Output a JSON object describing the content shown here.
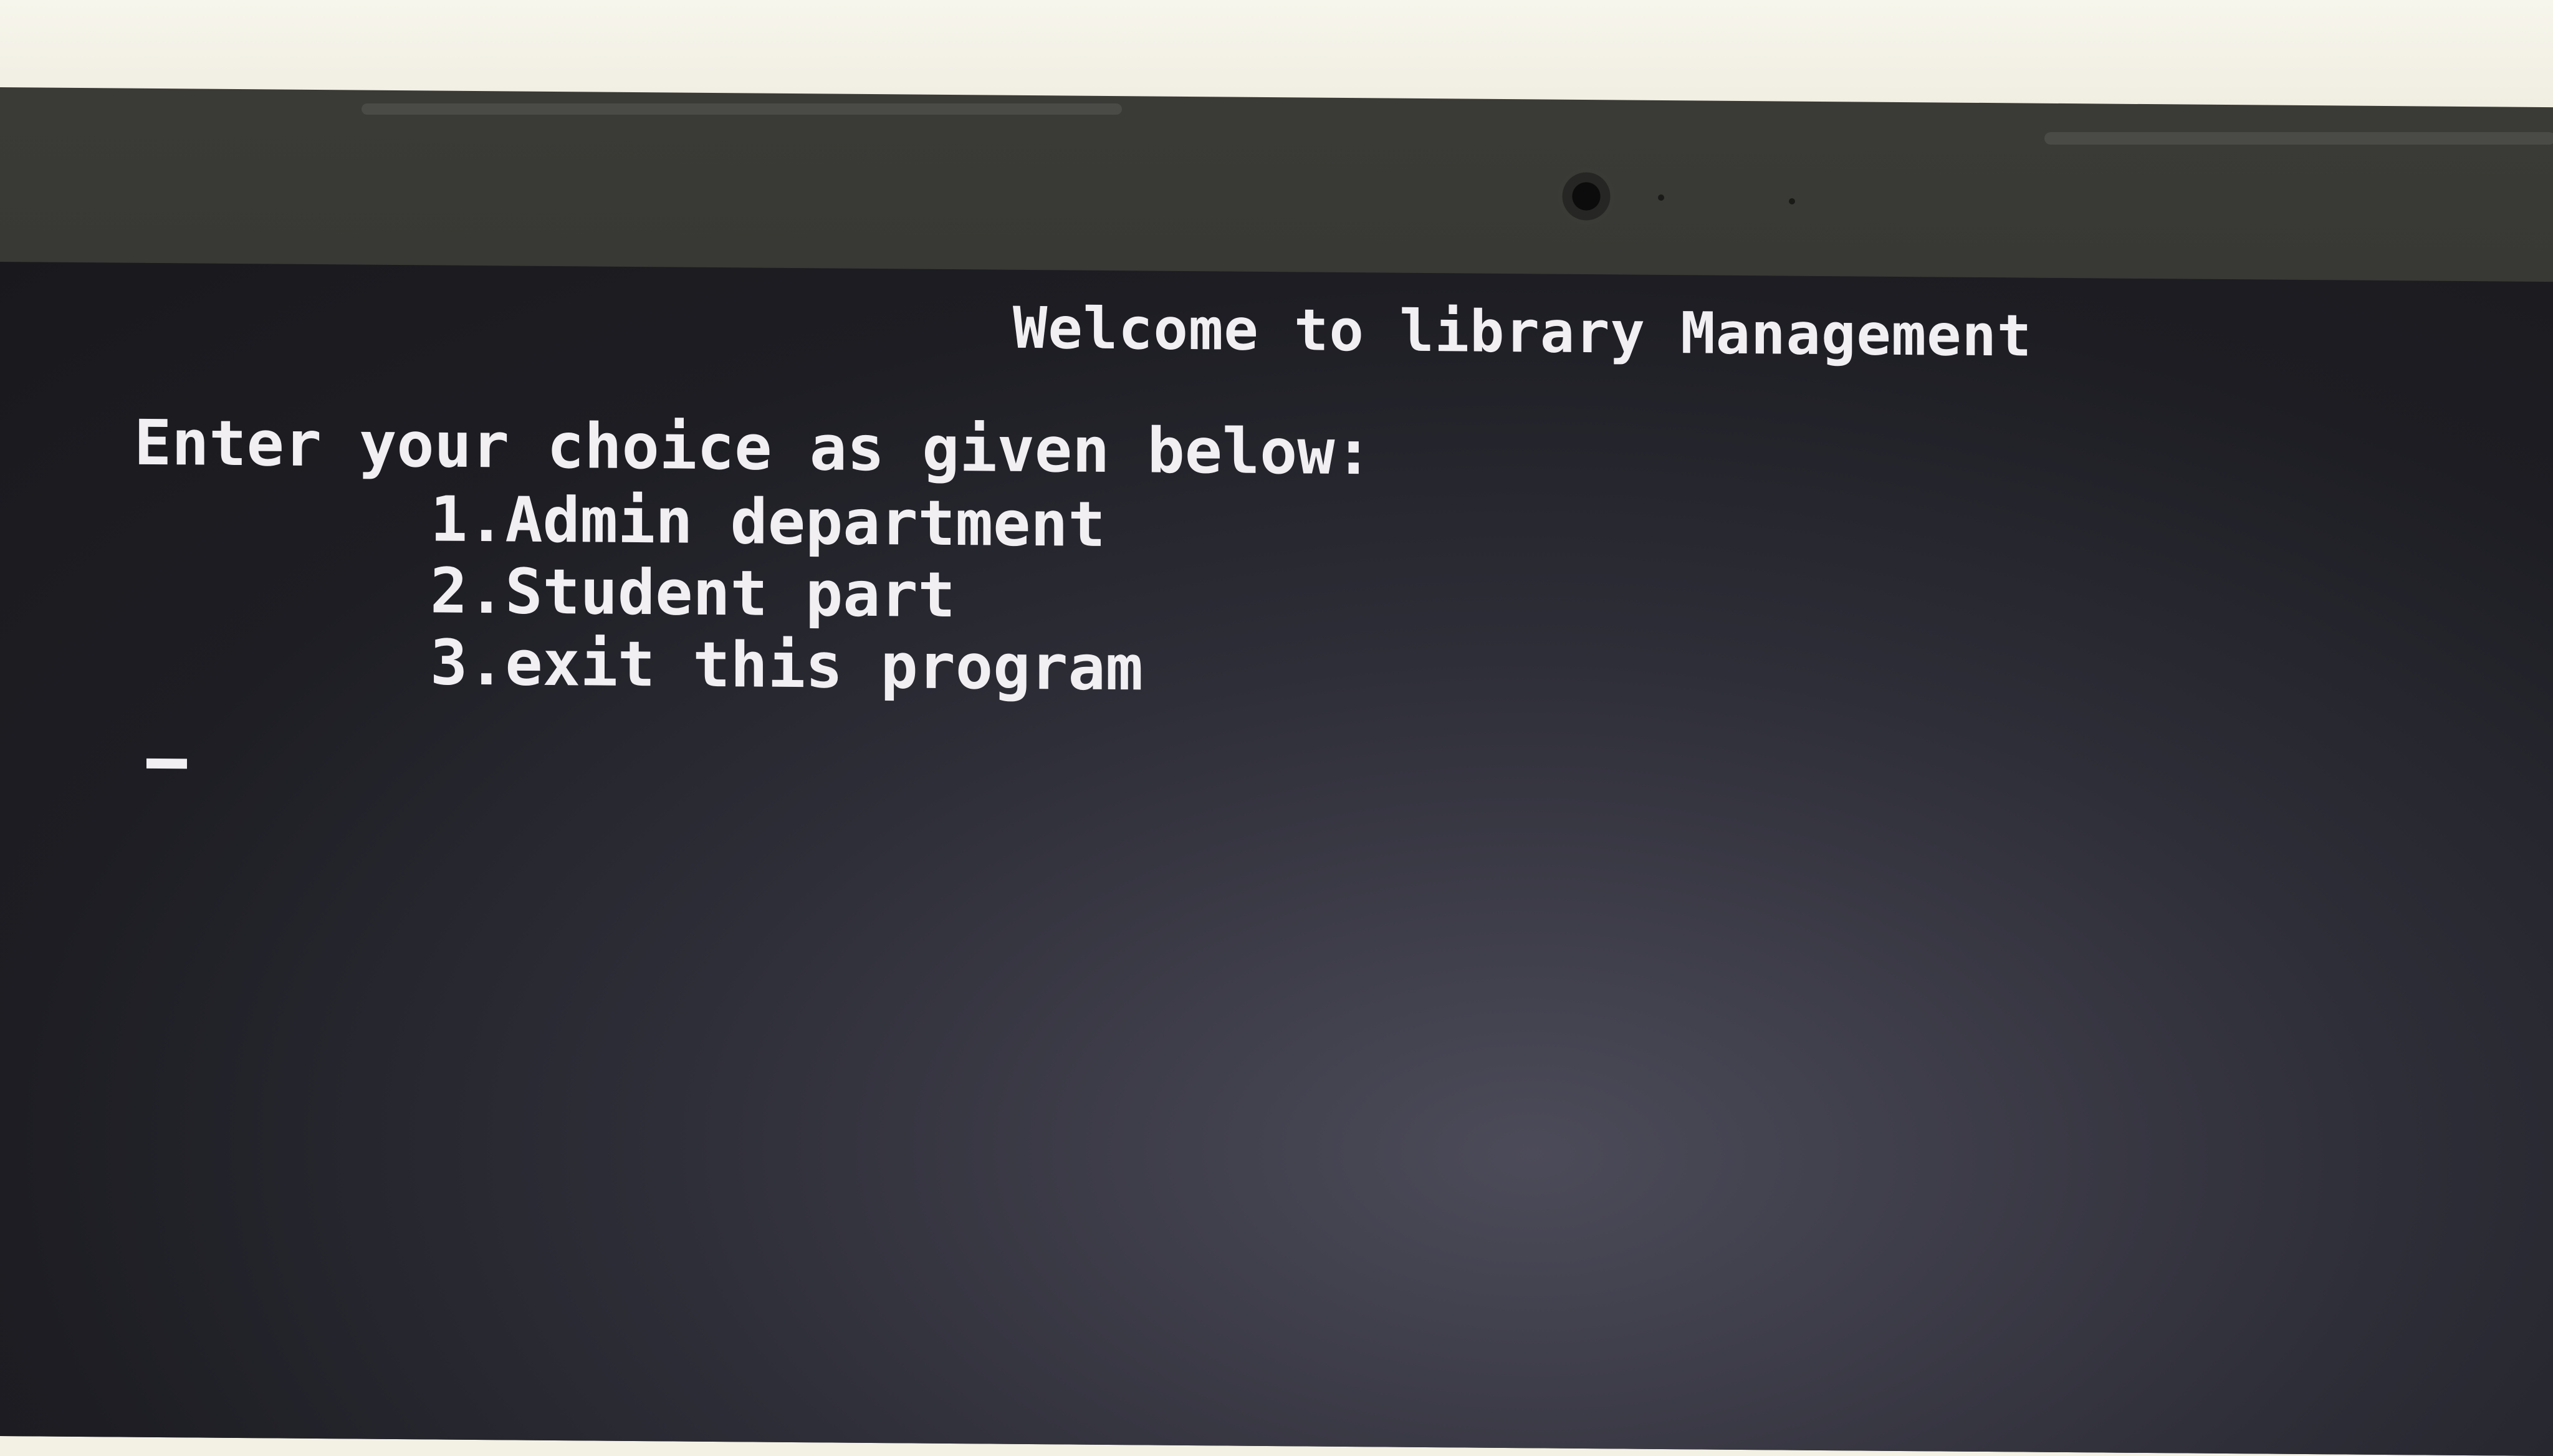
{
  "terminal": {
    "title": "Welcome to library Management",
    "prompt": "Enter your choice as given below:",
    "menu": [
      {
        "label": "1.Admin department"
      },
      {
        "label": "2.Student part"
      },
      {
        "label": "3.exit this program"
      }
    ],
    "cursor_char": "_"
  },
  "colors": {
    "screen_background": "#1d1d23",
    "text": "#f1eff2",
    "bezel": "#2c2c29"
  }
}
